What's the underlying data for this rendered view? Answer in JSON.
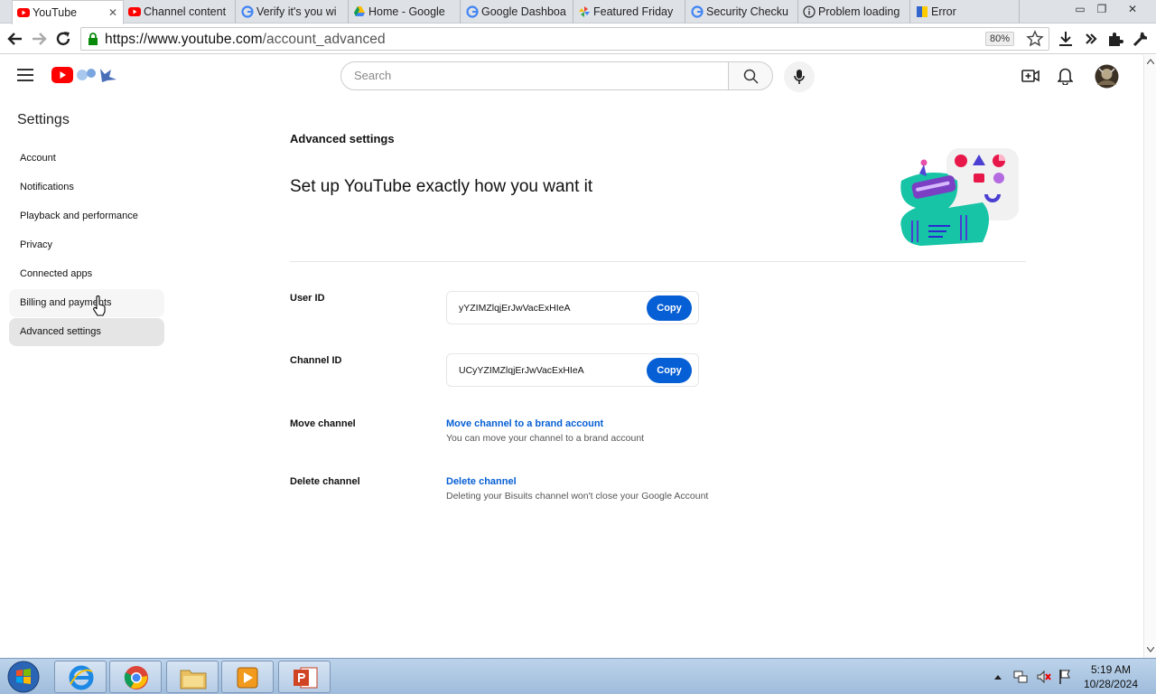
{
  "browser": {
    "tabs": [
      {
        "label": "YouTube",
        "icon": "youtube-icon",
        "active": true
      },
      {
        "label": "Channel content",
        "icon": "youtube-icon"
      },
      {
        "label": "Verify it's you wi",
        "icon": "google-icon"
      },
      {
        "label": "Home - Google",
        "icon": "google-drive-icon"
      },
      {
        "label": "Google Dashboa",
        "icon": "google-icon"
      },
      {
        "label": "Featured Friday",
        "icon": "pinwheel-icon"
      },
      {
        "label": "Security Checku",
        "icon": "google-icon"
      },
      {
        "label": "Problem loading",
        "icon": "info-icon"
      },
      {
        "label": "Error",
        "icon": "error-page-icon"
      }
    ],
    "url_scheme_host": "https://www.youtube.com",
    "url_path": "/account_advanced",
    "zoom": "80%"
  },
  "youtube": {
    "search_placeholder": "Search"
  },
  "sidebar": {
    "title": "Settings",
    "items": [
      {
        "label": "Account"
      },
      {
        "label": "Notifications"
      },
      {
        "label": "Playback and performance"
      },
      {
        "label": "Privacy"
      },
      {
        "label": "Connected apps"
      },
      {
        "label": "Billing and payments"
      },
      {
        "label": "Advanced settings"
      }
    ]
  },
  "main": {
    "section_title": "Advanced settings",
    "headline": "Set up YouTube exactly how you want it",
    "user_id_label": "User ID",
    "user_id_value": "yYZIMZlqjErJwVacExHIeA",
    "channel_id_label": "Channel ID",
    "channel_id_value": "UCyYZIMZlqjErJwVacExHIeA",
    "copy_label": "Copy",
    "move_label": "Move channel",
    "move_link": "Move channel to a brand account",
    "move_sub": "You can move your channel to a brand account",
    "delete_label": "Delete channel",
    "delete_link": "Delete channel",
    "delete_sub": "Deleting your Bisuits channel won't close your Google Account"
  },
  "taskbar": {
    "time": "5:19 AM",
    "date": "10/28/2024"
  },
  "colors": {
    "accent": "#065fd4",
    "youtube_red": "#ff0000"
  }
}
